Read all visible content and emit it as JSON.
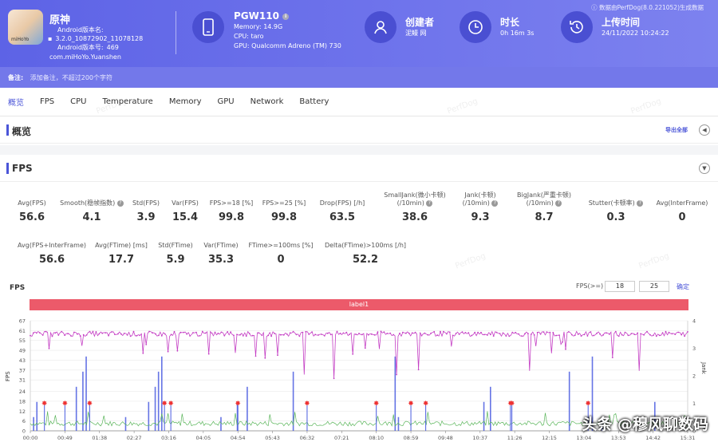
{
  "header": {
    "app_name": "原神",
    "android_version_name_label": "Android版本名:",
    "android_version_name": "3.2.0_10872902_11078128",
    "android_version_code_label": "Android版本号:",
    "android_version_code": "469",
    "package": "com.miHoYo.Yuanshen",
    "icon_caption": "miHoYo",
    "device": {
      "name": "PGW110",
      "memory": "Memory: 14.9G",
      "cpu": "CPU: taro",
      "gpu": "GPU: Qualcomm Adreno (TM) 730"
    },
    "creator": {
      "title": "创建者",
      "value": "泥鳗 网"
    },
    "duration": {
      "title": "时长",
      "value": "0h 16m 3s"
    },
    "upload": {
      "title": "上传时间",
      "value": "24/11/2022 10:24:22"
    },
    "source": "数据由PerfDog(8.0.221052)生成数据",
    "note_label": "备注:",
    "note_placeholder": "添加备注，不超过200个字符"
  },
  "tabs": [
    "概览",
    "FPS",
    "CPU",
    "Temperature",
    "Memory",
    "GPU",
    "Network",
    "Battery"
  ],
  "overview": {
    "title": "概览",
    "export": "导出全部"
  },
  "fps_section": {
    "title": "FPS"
  },
  "stats_row1": [
    {
      "label": "Avg(FPS)",
      "value": "56.6"
    },
    {
      "label": "Smooth(稳帧指数)",
      "value": "4.1"
    },
    {
      "label": "Std(FPS)",
      "value": "3.9"
    },
    {
      "label": "Var(FPS)",
      "value": "15.4"
    },
    {
      "label": "FPS>=18 [%]",
      "value": "99.8"
    },
    {
      "label": "FPS>=25 [%]",
      "value": "99.8"
    },
    {
      "label": "Drop(FPS) [/h]",
      "value": "63.5"
    },
    {
      "label": "SmallJank(微小卡顿)",
      "label2": "(/10min)",
      "value": "38.6"
    },
    {
      "label": "Jank(卡顿)",
      "label2": "(/10min)",
      "value": "9.3"
    },
    {
      "label": "BigJank(严重卡顿)",
      "label2": "(/10min)",
      "value": "8.7"
    },
    {
      "label": "Stutter(卡顿率)",
      "value": "0.3"
    },
    {
      "label": "Avg(InterFrame)",
      "value": "0"
    }
  ],
  "stats_row2": [
    {
      "label": "Avg(FPS+InterFrame)",
      "value": "56.6"
    },
    {
      "label": "Avg(FTime) [ms]",
      "value": "17.7"
    },
    {
      "label": "Std(FTime)",
      "value": "5.9"
    },
    {
      "label": "Var(FTime)",
      "value": "35.3"
    },
    {
      "label": "FTime>=100ms [%]",
      "value": "0"
    },
    {
      "label": "Delta(FTime)>100ms [/h]",
      "value": "52.2"
    }
  ],
  "chart_header": {
    "title": "FPS",
    "fps_gte_label": "FPS(>=)",
    "fps_gte_1": "18",
    "fps_gte_2": "25",
    "confirm": "确定",
    "label_bar": "label1"
  },
  "chart_data": {
    "type": "line",
    "ylabel": "FPS",
    "y2label": "Jank",
    "yticks": [
      0,
      6,
      12,
      18,
      24,
      31,
      37,
      43,
      49,
      55,
      61,
      67
    ],
    "y2ticks": [
      0,
      1,
      2,
      3,
      4
    ],
    "xticks": [
      "00:00",
      "00:49",
      "01:38",
      "02:27",
      "03:16",
      "04:05",
      "04:54",
      "05:43",
      "06:32",
      "07:21",
      "08:10",
      "08:59",
      "09:48",
      "10:37",
      "11:26",
      "12:15",
      "13:04",
      "13:53",
      "14:42",
      "15:31"
    ],
    "ylim": [
      0,
      67
    ],
    "y2lim": [
      0,
      4
    ],
    "series": [
      {
        "name": "FPS",
        "color": "#c43ec4",
        "baseline": 59
      },
      {
        "name": "InterFrame",
        "color": "#5ab55a",
        "baseline": 3
      },
      {
        "name": "Jank",
        "color": "#4a5ce0"
      }
    ],
    "big_jank_markers_time": [
      "00:20",
      "00:49",
      "01:24",
      "03:10",
      "03:19",
      "04:54",
      "06:32",
      "08:10",
      "08:59",
      "09:20",
      "11:20",
      "11:22",
      "13:10"
    ]
  },
  "colors": {
    "accent": "#4b55d8",
    "header": "#6a6ee8",
    "label_bar": "#ec5a6a"
  },
  "watermark": "头条 @穆风聊数码"
}
